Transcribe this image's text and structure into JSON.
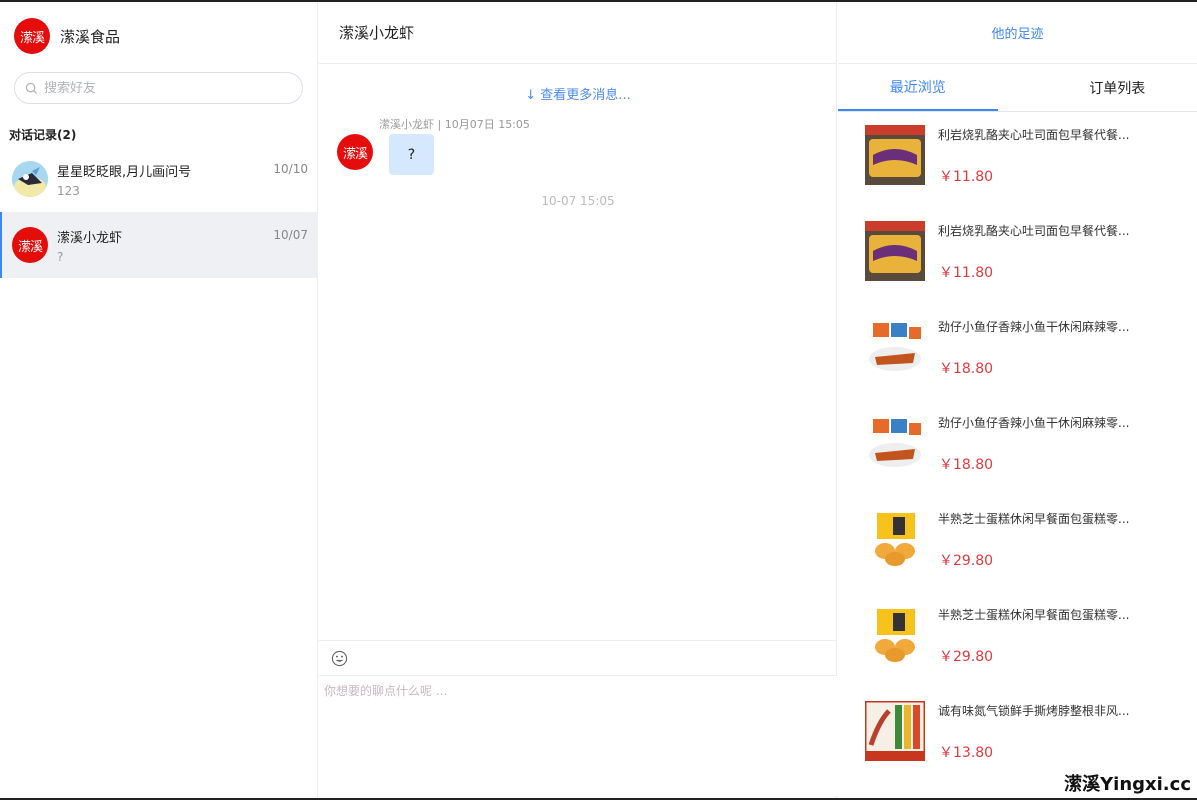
{
  "brand": {
    "logo_text": "潆溪",
    "name": "潆溪食品"
  },
  "search": {
    "placeholder": "搜索好友"
  },
  "conversations": {
    "title": "对话记录(2)",
    "items": [
      {
        "name": "星星眨眨眼,月儿画问号",
        "last_message": "123",
        "date": "10/10",
        "avatar": "cartoon-avatar"
      },
      {
        "name": "潆溪小龙虾",
        "last_message": "?",
        "date": "10/07",
        "avatar_text": "潆溪"
      }
    ]
  },
  "chat": {
    "title": "潆溪小龙虾",
    "more_messages": "↓ 查看更多消息...",
    "messages": [
      {
        "meta": "潆溪小龙虾 | 10月07日 15:05",
        "avatar_text": "潆溪",
        "text": "?"
      }
    ],
    "time_separator": "10-07 15:05",
    "input_placeholder": "你想要的聊点什么呢 ...",
    "emoji_icon": "smile-icon"
  },
  "footprint": {
    "title": "他的足迹",
    "tabs": [
      "最近浏览",
      "订单列表"
    ],
    "products": [
      {
        "title": "利岩烧乳酪夹心吐司面包早餐代餐...",
        "price": "￥11.80",
        "image": "toast"
      },
      {
        "title": "利岩烧乳酪夹心吐司面包早餐代餐...",
        "price": "￥11.80",
        "image": "toast"
      },
      {
        "title": "劲仔小鱼仔香辣小鱼干休闲麻辣零...",
        "price": "￥18.80",
        "image": "fish"
      },
      {
        "title": "劲仔小鱼仔香辣小鱼干休闲麻辣零...",
        "price": "￥18.80",
        "image": "fish"
      },
      {
        "title": "半熟芝士蛋糕休闲早餐面包蛋糕零...",
        "price": "￥29.80",
        "image": "cake"
      },
      {
        "title": "半熟芝士蛋糕休闲早餐面包蛋糕零...",
        "price": "￥29.80",
        "image": "cake"
      },
      {
        "title": "诚有味氮气锁鲜手撕烤脖整根非风...",
        "price": "￥13.80",
        "image": "neck"
      }
    ]
  },
  "watermark": "潆溪Yingxi.cc",
  "colors": {
    "accent": "#3d87f5",
    "price": "#e4393c",
    "logo": "#e50c0c",
    "bubble": "#d6e8fd"
  }
}
